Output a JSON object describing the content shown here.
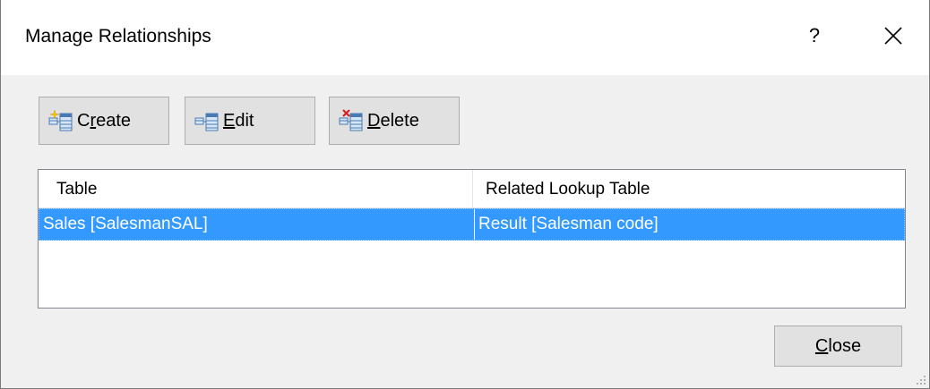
{
  "dialog": {
    "title": "Manage Relationships",
    "help_label": "?"
  },
  "toolbar": {
    "create": {
      "pre": "C",
      "mnemonic": "r",
      "post": "eate",
      "icon": "table-new-icon"
    },
    "edit": {
      "pre": "",
      "mnemonic": "E",
      "post": "dit",
      "icon": "table-edit-icon"
    },
    "delete": {
      "pre": "",
      "mnemonic": "D",
      "post": "elete",
      "icon": "table-delete-icon"
    }
  },
  "grid": {
    "columns": [
      "Table",
      "Related Lookup Table"
    ],
    "rows": [
      {
        "table": "Sales [SalesmanSAL]",
        "related": "Result [Salesman code]",
        "selected": true
      }
    ]
  },
  "footer": {
    "close": {
      "mnemonic": "C",
      "post": "lose"
    }
  },
  "colors": {
    "selection": "#3399ff",
    "button_face": "#e1e1e1",
    "dialog_bg": "#f0f0f0"
  }
}
